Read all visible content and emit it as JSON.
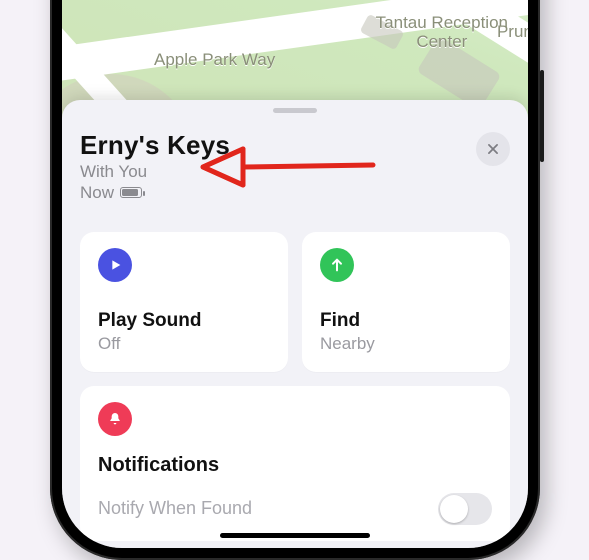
{
  "map": {
    "labels": {
      "apple_park": "Apple Park Way",
      "tantau": "Tantau Reception\nCenter",
      "pruneridge": "Pruner"
    }
  },
  "item": {
    "title": "Erny's Keys",
    "status_line1": "With You",
    "status_line2": "Now"
  },
  "tiles": {
    "play": {
      "label": "Play Sound",
      "sub": "Off"
    },
    "find": {
      "label": "Find",
      "sub": "Nearby"
    }
  },
  "notifications": {
    "heading": "Notifications",
    "notify_when_found": "Notify When Found"
  }
}
